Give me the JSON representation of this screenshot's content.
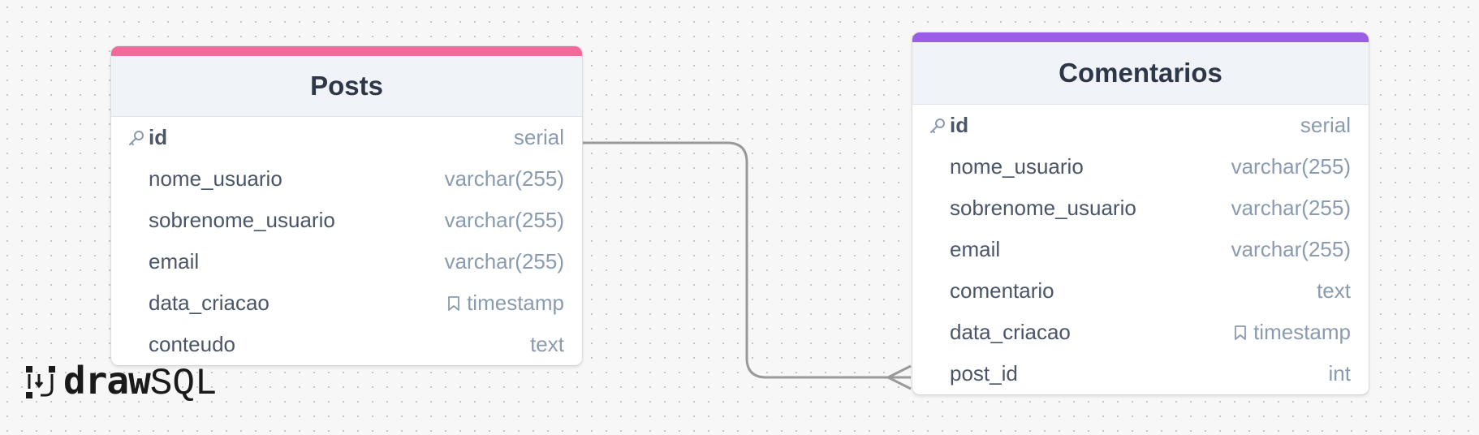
{
  "colors": {
    "posts_accent": "#f06b9a",
    "comentarios_accent": "#9b5de5",
    "connector": "#999999"
  },
  "tables": [
    {
      "title": "Posts",
      "columns": [
        {
          "name": "id",
          "type": "serial",
          "primary_key": true,
          "icon": "key-icon"
        },
        {
          "name": "nome_usuario",
          "type": "varchar(255)"
        },
        {
          "name": "sobrenome_usuario",
          "type": "varchar(255)"
        },
        {
          "name": "email",
          "type": "varchar(255)"
        },
        {
          "name": "data_criacao",
          "type": "timestamp",
          "type_icon": "bookmark-icon"
        },
        {
          "name": "conteudo",
          "type": "text"
        }
      ]
    },
    {
      "title": "Comentarios",
      "columns": [
        {
          "name": "id",
          "type": "serial",
          "primary_key": true,
          "icon": "key-icon"
        },
        {
          "name": "nome_usuario",
          "type": "varchar(255)"
        },
        {
          "name": "sobrenome_usuario",
          "type": "varchar(255)"
        },
        {
          "name": "email",
          "type": "varchar(255)"
        },
        {
          "name": "comentario",
          "type": "text"
        },
        {
          "name": "data_criacao",
          "type": "timestamp",
          "type_icon": "bookmark-icon"
        },
        {
          "name": "post_id",
          "type": "int"
        }
      ]
    }
  ],
  "relationship": {
    "from": "Posts.id",
    "to": "Comentarios.post_id",
    "cardinality": "one-to-many"
  },
  "logo": {
    "bold": "draw",
    "thin": "SQL"
  }
}
